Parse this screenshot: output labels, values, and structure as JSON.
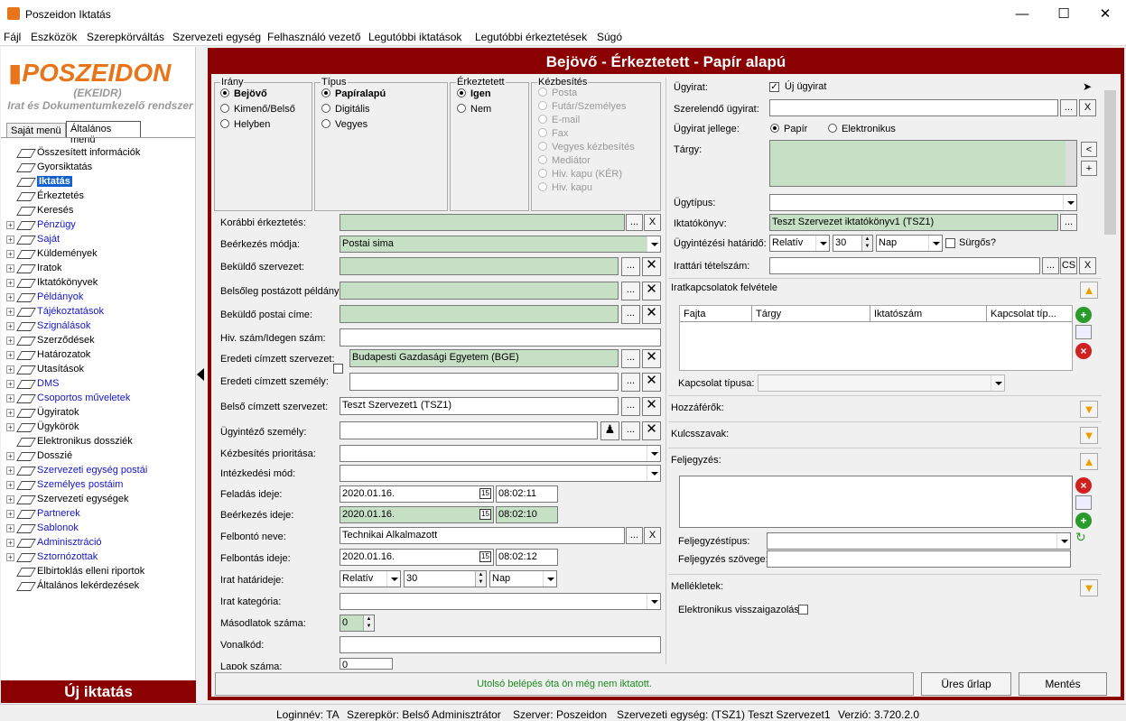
{
  "window": {
    "title": "Poszeidon Iktatás"
  },
  "menu": [
    "Fájl",
    "Eszközök",
    "Szerepkörváltás",
    "Szervezeti egység",
    "Felhasználó vezető",
    "Legutóbbi iktatások",
    "Legutóbbi érkeztetések",
    "Súgó"
  ],
  "logo": {
    "name": "POSZEIDON",
    "sub1": "(EKEIDR)",
    "sub2": "Irat és Dokumentumkezelő rendszer"
  },
  "left_tabs": [
    "Saját menü",
    "Általános menü"
  ],
  "tree": [
    {
      "label": "Összesített információk",
      "exp": false,
      "blue": false
    },
    {
      "label": "Gyorsiktatás",
      "exp": false,
      "blue": false
    },
    {
      "label": "Iktatás",
      "exp": false,
      "blue": false,
      "selected": true
    },
    {
      "label": "Érkeztetés",
      "exp": false,
      "blue": false
    },
    {
      "label": "Keresés",
      "exp": false,
      "blue": false
    },
    {
      "label": "Pénzügy",
      "exp": true,
      "blue": true
    },
    {
      "label": "Saját",
      "exp": true,
      "blue": true
    },
    {
      "label": "Küldemények",
      "exp": true,
      "blue": false
    },
    {
      "label": "Iratok",
      "exp": true,
      "blue": false
    },
    {
      "label": "Iktatókönyvek",
      "exp": true,
      "blue": false
    },
    {
      "label": "Példányok",
      "exp": true,
      "blue": true
    },
    {
      "label": "Tájékoztatások",
      "exp": true,
      "blue": true
    },
    {
      "label": "Szignálások",
      "exp": true,
      "blue": true
    },
    {
      "label": "Szerződések",
      "exp": true,
      "blue": false
    },
    {
      "label": "Határozatok",
      "exp": true,
      "blue": false
    },
    {
      "label": "Utasítások",
      "exp": true,
      "blue": false
    },
    {
      "label": "DMS",
      "exp": true,
      "blue": true
    },
    {
      "label": "Csoportos műveletek",
      "exp": true,
      "blue": true
    },
    {
      "label": "Ügyiratok",
      "exp": true,
      "blue": false
    },
    {
      "label": "Ügykörök",
      "exp": true,
      "blue": false
    },
    {
      "label": "Elektronikus dossziék",
      "exp": false,
      "blue": false
    },
    {
      "label": "Dosszié",
      "exp": true,
      "blue": false
    },
    {
      "label": "Szervezeti egység postái",
      "exp": true,
      "blue": true
    },
    {
      "label": "Személyes postáim",
      "exp": true,
      "blue": true
    },
    {
      "label": "Szervezeti egységek",
      "exp": true,
      "blue": false
    },
    {
      "label": "Partnerek",
      "exp": true,
      "blue": true
    },
    {
      "label": "Sablonok",
      "exp": true,
      "blue": true
    },
    {
      "label": "Adminisztráció",
      "exp": true,
      "blue": true
    },
    {
      "label": "Sztornózottak",
      "exp": true,
      "blue": true
    },
    {
      "label": "Elbirtoklás elleni riportok",
      "exp": false,
      "blue": false
    },
    {
      "label": "Általános lekérdezések",
      "exp": false,
      "blue": false
    }
  ],
  "new_registration": "Új iktatás",
  "form_title": "Bejövő - Érkeztetett - Papír alapú",
  "groups": {
    "irany": {
      "title": "Irány",
      "options": [
        "Bejövő",
        "Kimenő/Belső",
        "Helyben"
      ],
      "selected": 0
    },
    "tipus": {
      "title": "Típus",
      "options": [
        "Papíralapú",
        "Digitális",
        "Vegyes"
      ],
      "selected": 0
    },
    "erkeztetett": {
      "title": "Érkeztetett",
      "options": [
        "Igen",
        "Nem"
      ],
      "selected": 0
    },
    "kezbesites": {
      "title": "Kézbesítés",
      "options": [
        "Posta",
        "Futár/Személyes",
        "E-mail",
        "Fax",
        "Vegyes kézbesítés",
        "Mediátor",
        "Hiv. kapu (KÉR)",
        "Hiv. kapu"
      ]
    }
  },
  "left_form": {
    "korabbi": {
      "label": "Korábbi érkeztetés:",
      "value": ""
    },
    "beerkezes_modja": {
      "label": "Beérkezés módja:",
      "value": "Postai sima"
    },
    "bekuldo_szerv": {
      "label": "Beküldő szervezet:",
      "value": ""
    },
    "belsoleg": {
      "label": "Belsőleg postázott példány r",
      "value": ""
    },
    "bekuldo_cim": {
      "label": "Beküldő postai címe:",
      "value": ""
    },
    "hiv_szam": {
      "label": "Hiv. szám/Idegen szám:",
      "value": ""
    },
    "eredeti_szerv": {
      "label": "Eredeti címzett szervezet:",
      "value": "Budapesti Gazdasági Egyetem (BGE)"
    },
    "eredeti_szemely": {
      "label": "Eredeti címzett személy:",
      "value": ""
    },
    "belso_cimzett": {
      "label": "Belső címzett szervezet:",
      "value": "Teszt Szervezet1 (TSZ1)"
    },
    "ugyintezo": {
      "label": "Ügyintéző személy:",
      "value": ""
    },
    "prioritas": {
      "label": "Kézbesítés prioritása:",
      "value": ""
    },
    "intezkedesi": {
      "label": "Intézkedési mód:",
      "value": ""
    },
    "feladas": {
      "label": "Feladás ideje:",
      "date": "2020.01.16.",
      "time": "08:02:11"
    },
    "beerkezes_ideje": {
      "label": "Beérkezés ideje:",
      "date": "2020.01.16.",
      "time": "08:02:10"
    },
    "felbonto": {
      "label": "Felbontó neve:",
      "value": "Technikai Alkalmazott"
    },
    "felbontas": {
      "label": "Felbontás ideje:",
      "date": "2020.01.16.",
      "time": "08:02:12"
    },
    "hatarido": {
      "label": "Irat határideje:",
      "mode": "Relatív",
      "num": "30",
      "unit": "Nap"
    },
    "kategoria": {
      "label": "Irat kategória:",
      "value": ""
    },
    "masodlatok": {
      "label": "Másodlatok száma:",
      "value": "0"
    },
    "vonalkod": {
      "label": "Vonalkód:",
      "value": ""
    },
    "lapok": {
      "label": "Lapok száma:",
      "value": "0"
    }
  },
  "right_form": {
    "ugyirat": {
      "label": "Ügyirat:",
      "check_label": "Új ügyirat",
      "checked": true
    },
    "szerelendo": {
      "label": "Szerelendő ügyirat:",
      "value": ""
    },
    "jellege": {
      "label": "Ügyirat jellege:",
      "options": [
        "Papír",
        "Elektronikus"
      ],
      "selected": 0
    },
    "targy": {
      "label": "Tárgy:",
      "value": ""
    },
    "ugytipus": {
      "label": "Ügytípus:",
      "value": ""
    },
    "iktatokonyv": {
      "label": "Iktatókönyv:",
      "value": "Teszt Szervezet iktatókönyv1 (TSZ1)"
    },
    "hatarido": {
      "label": "Ügyintézési határidő:",
      "mode": "Relatív",
      "num": "30",
      "unit": "Nap",
      "urgent_label": "Sürgős?"
    },
    "irattari": {
      "label": "Irattári tételszám:",
      "value": "",
      "btn": "CS"
    },
    "iratkapcsolatok": {
      "title": "Iratkapcsolatok felvétele",
      "columns": [
        "Fajta",
        "Tárgy",
        "Iktatószám",
        "Kapcsolat típ..."
      ],
      "type_label": "Kapcsolat típusa:"
    },
    "hozzaferok": "Hozzáférők:",
    "kulcsszavak": "Kulcsszavak:",
    "feljegyzes": {
      "title": "Feljegyzés:",
      "type_label": "Feljegyzéstípus:",
      "text_label": "Feljegyzés szövege:"
    },
    "mellekletek": "Mellékletek:",
    "visszaigazolas": "Elektronikus visszaigazolás:"
  },
  "bottom": {
    "status": "Utolsó belépés óta ön még nem iktatott.",
    "clear": "Üres űrlap",
    "save": "Mentés"
  },
  "statusbar": {
    "login": "Loginnév: TA",
    "role": "Szerepkör: Belső Adminisztrátor",
    "server": "Szerver: Poszeidon",
    "unit": "Szervezeti egység: (TSZ1) Teszt Szervezet1",
    "version": "Verzió: 3.720.2.0"
  },
  "colors": {
    "brand": "#e8751a",
    "frame": "#8b0000",
    "filled": "#c6e0c6",
    "link": "#1515c8"
  }
}
